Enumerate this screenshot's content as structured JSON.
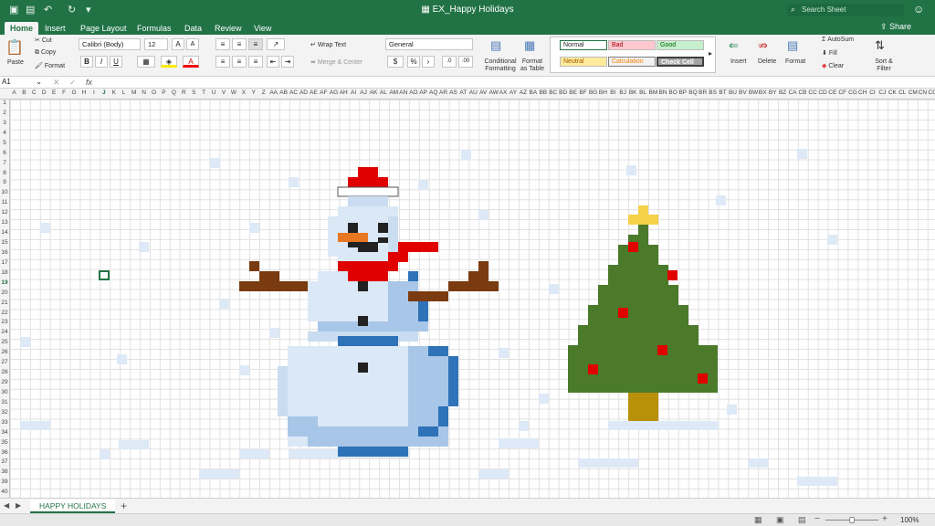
{
  "titlebar": {
    "title": "EX_Happy Holidays",
    "search_placeholder": "Search Sheet"
  },
  "tabs": [
    "Home",
    "Insert",
    "Page Layout",
    "Formulas",
    "Data",
    "Review",
    "View"
  ],
  "share_label": "Share",
  "ribbon": {
    "paste": "Paste",
    "cut": "Cut",
    "copy": "Copy",
    "format_painter": "Format",
    "font": "Calibri (Body)",
    "size": "12",
    "wrap": "Wrap Text",
    "merge": "Merge & Center",
    "number_format": "General",
    "conditional": "Conditional Formatting",
    "format_table": "Format as Table",
    "styles": {
      "normal": "Normal",
      "bad": "Bad",
      "good": "Good",
      "neutral": "Neutral",
      "calculation": "Calculation",
      "check": "Check Cell"
    },
    "insert": "Insert",
    "delete": "Delete",
    "format": "Format",
    "autosum": "AutoSum",
    "fill": "Fill",
    "clear": "Clear",
    "sort": "Sort & Filter"
  },
  "formula_bar": {
    "namebox": "A1",
    "fx": "fx"
  },
  "columns": [
    "A",
    "B",
    "C",
    "D",
    "E",
    "F",
    "G",
    "H",
    "I",
    "J",
    "K",
    "L",
    "M",
    "N",
    "O",
    "P",
    "Q",
    "R",
    "S",
    "T",
    "U",
    "V",
    "W",
    "X",
    "Y",
    "Z",
    "AA",
    "AB",
    "AC",
    "AD",
    "AE",
    "AF",
    "AG",
    "AH",
    "AI",
    "AJ",
    "AK",
    "AL",
    "AM",
    "AN",
    "AO",
    "AP",
    "AQ",
    "AR",
    "AS",
    "AT",
    "AU",
    "AV",
    "AW",
    "AX",
    "AY",
    "AZ",
    "BA",
    "BB",
    "BC",
    "BD",
    "BE",
    "BF",
    "BG",
    "BH",
    "BI",
    "BJ",
    "BK",
    "BL",
    "BM",
    "BN",
    "BO",
    "BP",
    "BQ",
    "BR",
    "BS",
    "BT",
    "BU",
    "BV",
    "BW",
    "BX",
    "BY",
    "BZ",
    "CA",
    "CB",
    "CC",
    "CD",
    "CE",
    "CF",
    "CG",
    "CH",
    "CI",
    "CJ",
    "CK",
    "CL",
    "CM",
    "CN",
    "CO"
  ],
  "rows": [
    "1",
    "2",
    "3",
    "4",
    "5",
    "6",
    "7",
    "8",
    "9",
    "10",
    "11",
    "12",
    "13",
    "14",
    "15",
    "16",
    "17",
    "18",
    "19",
    "20",
    "21",
    "22",
    "23",
    "24",
    "25",
    "26",
    "27",
    "28",
    "29",
    "30",
    "31",
    "32",
    "33",
    "34",
    "35",
    "36",
    "37",
    "38",
    "39",
    "40"
  ],
  "sheet_tab": "HAPPY HOLIDAYS",
  "zoom": "100%"
}
